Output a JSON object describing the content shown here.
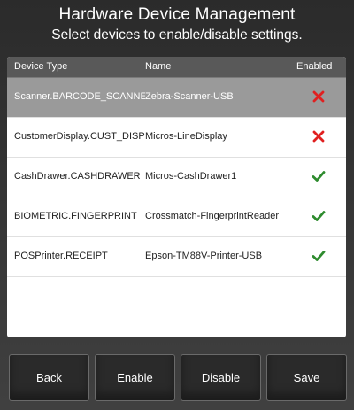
{
  "header": {
    "title": "Hardware Device Management",
    "subtitle": "Select devices to enable/disable settings."
  },
  "table": {
    "columns": [
      "Device Type",
      "Name",
      "Enabled"
    ],
    "rows": [
      {
        "device_type": "Scanner.BARCODE_SCANNER",
        "name": "Zebra-Scanner-USB",
        "enabled": false,
        "selected": true
      },
      {
        "device_type": "CustomerDisplay.CUST_DISPLAY",
        "name": "Micros-LineDisplay",
        "enabled": false,
        "selected": false
      },
      {
        "device_type": "CashDrawer.CASHDRAWER",
        "name": "Micros-CashDrawer1",
        "enabled": true,
        "selected": false
      },
      {
        "device_type": "BIOMETRIC.FINGERPRINT",
        "name": "Crossmatch-FingerprintReader",
        "enabled": true,
        "selected": false
      },
      {
        "device_type": "POSPrinter.RECEIPT",
        "name": "Epson-TM88V-Printer-USB",
        "enabled": true,
        "selected": false
      }
    ],
    "enabled_icon": "check-icon",
    "disabled_icon": "cross-icon",
    "enabled_color": "#2e8b2e",
    "disabled_color": "#e02020"
  },
  "buttons": {
    "back": "Back",
    "enable": "Enable",
    "disable": "Disable",
    "save": "Save"
  }
}
